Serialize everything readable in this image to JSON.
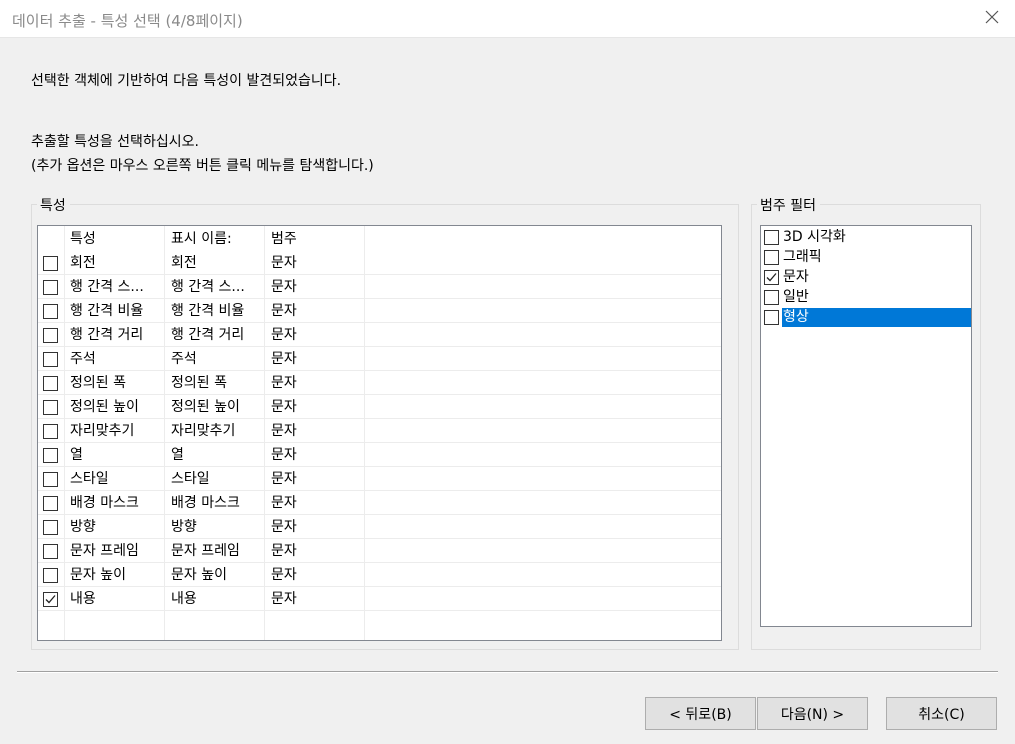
{
  "window": {
    "title": "데이터 추출 - 특성 선택 (4/8페이지)"
  },
  "intro": {
    "line1": "선택한 객체에 기반하여 다음 특성이 발견되었습니다.",
    "line2": "추출할 특성을 선택하십시오.",
    "line3": "(추가 옵션은 마우스 오른쪽 버튼 클릭 메뉴를 탐색합니다.)"
  },
  "properties": {
    "group_label": "특성",
    "columns": [
      "특성",
      "표시 이름:",
      "범주"
    ],
    "rows": [
      {
        "checked": false,
        "name": "회전",
        "display": "회전",
        "category": "문자"
      },
      {
        "checked": false,
        "name": "행 간격 스...",
        "display": "행 간격 스...",
        "category": "문자"
      },
      {
        "checked": false,
        "name": "행 간격 비율",
        "display": "행 간격 비율",
        "category": "문자"
      },
      {
        "checked": false,
        "name": "행 간격 거리",
        "display": "행 간격 거리",
        "category": "문자"
      },
      {
        "checked": false,
        "name": "주석",
        "display": "주석",
        "category": "문자"
      },
      {
        "checked": false,
        "name": "정의된 폭",
        "display": "정의된 폭",
        "category": "문자"
      },
      {
        "checked": false,
        "name": "정의된 높이",
        "display": "정의된 높이",
        "category": "문자"
      },
      {
        "checked": false,
        "name": "자리맞추기",
        "display": "자리맞추기",
        "category": "문자"
      },
      {
        "checked": false,
        "name": "열",
        "display": "열",
        "category": "문자"
      },
      {
        "checked": false,
        "name": "스타일",
        "display": "스타일",
        "category": "문자"
      },
      {
        "checked": false,
        "name": "배경 마스크",
        "display": "배경 마스크",
        "category": "문자"
      },
      {
        "checked": false,
        "name": "방향",
        "display": "방향",
        "category": "문자"
      },
      {
        "checked": false,
        "name": "문자 프레임",
        "display": "문자 프레임",
        "category": "문자"
      },
      {
        "checked": false,
        "name": "문자 높이",
        "display": "문자 높이",
        "category": "문자"
      },
      {
        "checked": true,
        "name": "내용",
        "display": "내용",
        "category": "문자"
      }
    ]
  },
  "category_filter": {
    "group_label": "범주 필터",
    "items": [
      {
        "label": "3D 시각화",
        "checked": false,
        "selected": false
      },
      {
        "label": "그래픽",
        "checked": false,
        "selected": false
      },
      {
        "label": "문자",
        "checked": true,
        "selected": false
      },
      {
        "label": "일반",
        "checked": false,
        "selected": false
      },
      {
        "label": "형상",
        "checked": false,
        "selected": true
      }
    ]
  },
  "buttons": {
    "back": "< 뒤로(B)",
    "next": "다음(N) >",
    "cancel": "취소(C)"
  },
  "colors": {
    "selection": "#0078d7",
    "dialog_bg": "#f0f0f0",
    "button_bg": "#e1e1e1"
  }
}
